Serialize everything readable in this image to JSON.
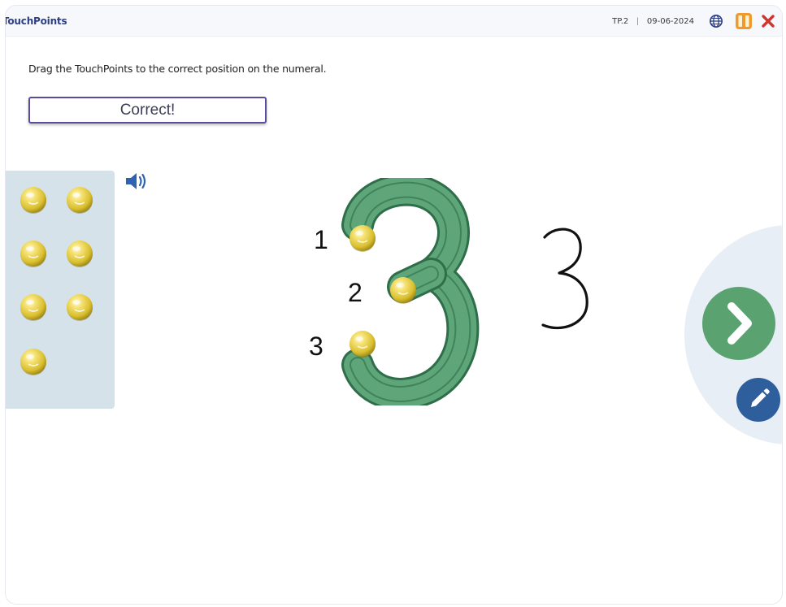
{
  "header": {
    "app_title": "TouchPoints",
    "code": "TP.2",
    "separator": "|",
    "date": "09-06-2024",
    "icons": [
      "globe-icon",
      "pause-icon",
      "close-icon"
    ]
  },
  "instruction": "Drag the TouchPoints to the correct position on the numeral.",
  "feedback": "Correct!",
  "tray": {
    "ball_count": 7,
    "icon": "touchpoint-ball-icon"
  },
  "numeral": {
    "value": "3",
    "labels": [
      "1",
      "2",
      "3"
    ],
    "handwritten": "3"
  },
  "buttons": {
    "next_icon": "chevron-right-icon",
    "edit_icon": "pencil-icon"
  },
  "colors": {
    "numeral_green": "#5fa57a",
    "next_button": "#5aa370",
    "edit_button": "#2f5e9c",
    "tray_bg": "#d6e2ea",
    "title_blue": "#2b3f86",
    "close_red": "#d1342d",
    "pause_orange": "#f09a2c"
  }
}
